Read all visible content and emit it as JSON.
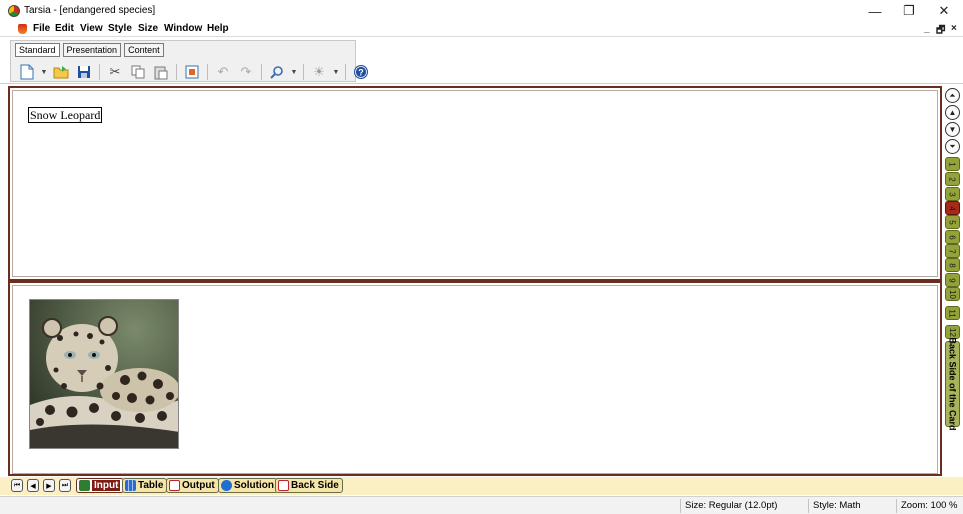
{
  "window": {
    "app_name": "Tarsia",
    "title": "Tarsia - [endangered species]",
    "controls": {
      "minimize": "—",
      "restore": "❐",
      "close": "✕"
    }
  },
  "menu": {
    "items": [
      "File",
      "Edit",
      "View",
      "Style",
      "Size",
      "Window",
      "Help"
    ],
    "mdi_controls": {
      "minimize": "_",
      "restore": "🗗",
      "close": "×"
    }
  },
  "toolbar": {
    "tabs": [
      "Standard",
      "Presentation",
      "Content"
    ],
    "active_tab": "Standard",
    "icons": [
      "new-icon",
      "dropdown-arrow-icon",
      "open-icon",
      "save-icon",
      "cut-icon",
      "copy-icon",
      "paste-icon",
      "image-icon",
      "undo-icon",
      "redo-icon",
      "zoom-icon",
      "dropdown-arrow-icon",
      "brightness-icon",
      "dropdown-arrow-icon",
      "help-icon"
    ]
  },
  "card": {
    "front_text": "Snow Leopard",
    "back_image": "snow-leopard-photo"
  },
  "side_tabs": {
    "numbers": [
      "1",
      "2",
      "3",
      "4",
      "5",
      "6",
      "7",
      "8",
      "9",
      "10",
      "11",
      "12"
    ],
    "active": "4",
    "back_label": "Back Side of the Card"
  },
  "bottom_tabs": {
    "items": [
      "Input",
      "Table",
      "Output",
      "Solution",
      "Back Side"
    ],
    "active": "Input"
  },
  "status": {
    "size": "Size: Regular (12.0pt)",
    "style": "Style: Math",
    "zoom": "Zoom: 100 %"
  },
  "colors": {
    "card_border": "#6b2d1e",
    "tab_green": "#94a23a",
    "tab_active": "#a52a1a",
    "bottom_bar": "#fbefc4"
  }
}
